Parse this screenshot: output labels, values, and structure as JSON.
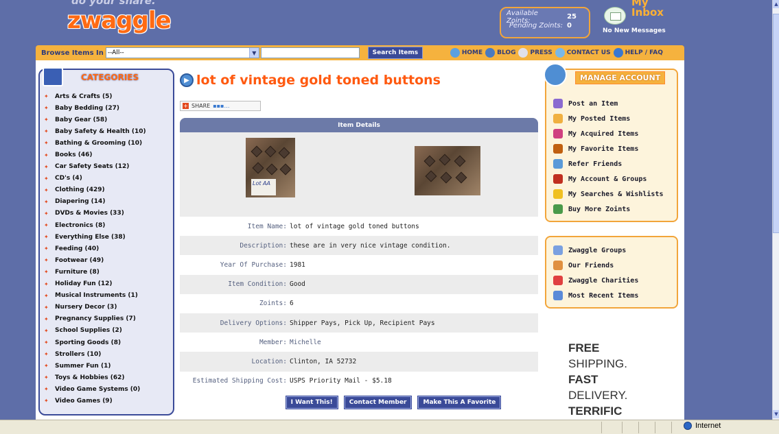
{
  "header": {
    "tagline": "do your share.",
    "logo": "zwaggle",
    "available_label": "Available Zoints:",
    "available_value": "25",
    "pending_label": "Pending Zoints:",
    "pending_value": "0",
    "inbox_title": "My Inbox",
    "inbox_sub": "No New Messages"
  },
  "nav": {
    "browse_label": "Browse Items In",
    "browse_value": "--All--",
    "search_button": "Search Items",
    "links": [
      "HOME",
      "BLOG",
      "PRESS",
      "CONTACT US",
      "HELP / FAQ"
    ]
  },
  "categories": {
    "title": "CATEGORIES",
    "items": [
      "Arts & Crafts (5)",
      "Baby Bedding (27)",
      "Baby Gear (58)",
      "Baby Safety & Health (10)",
      "Bathing & Grooming (10)",
      "Books (46)",
      "Car Safety Seats (12)",
      "CD's (4)",
      "Clothing (429)",
      "Diapering (14)",
      "DVDs & Movies (33)",
      "Electronics (8)",
      "Everything Else (38)",
      "Feeding (40)",
      "Footwear (49)",
      "Furniture (8)",
      "Holiday Fun (12)",
      "Musical Instruments (1)",
      "Nursery Decor (3)",
      "Pregnancy Supplies (7)",
      "School Supplies (2)",
      "Sporting Goods (8)",
      "Strollers (10)",
      "Summer Fun (1)",
      "Toys & Hobbies (62)",
      "Video Game Systems (0)",
      "Video Games (9)"
    ]
  },
  "item": {
    "title": "lot of vintage gold toned buttons",
    "share_label": "SHARE",
    "details_header": "Item Details",
    "photo_card_text": "Lot AA",
    "rows": [
      {
        "label": "Item Name:",
        "value": "lot of vintage gold toned buttons"
      },
      {
        "label": "Description:",
        "value": "these are in very nice vintage condition."
      },
      {
        "label": "Year Of Purchase:",
        "value": "1981"
      },
      {
        "label": "Item Condition:",
        "value": "Good"
      },
      {
        "label": "Zoints:",
        "value": "6"
      },
      {
        "label": "Delivery Options:",
        "value": "Shipper Pays, Pick Up, Recipient Pays"
      },
      {
        "label": "Member:",
        "value": "Michelle"
      },
      {
        "label": "Location:",
        "value": "Clinton, IA 52732"
      },
      {
        "label": "Estimated Shipping Cost:",
        "value": "USPS Priority Mail - $5.18"
      }
    ],
    "buttons": {
      "want": "I Want This!",
      "contact": "Contact Member",
      "favorite": "Make This A Favorite"
    }
  },
  "manage": {
    "title": "MANAGE ACCOUNT",
    "items": [
      "Post an Item",
      "My Posted Items",
      "My Acquired Items",
      "My Favorite Items",
      "Refer Friends",
      "My Account & Groups",
      "My Searches & Wishlists",
      "Buy More Zoints"
    ]
  },
  "groups": {
    "items": [
      "Zwaggle Groups",
      "Our Friends",
      "Zwaggle Charities",
      "Most Recent Items"
    ]
  },
  "ad": {
    "l1": "FREE",
    "l2": "SHIPPING.",
    "l3": "FAST",
    "l4": "DELIVERY.",
    "l5": "TERRIFIC"
  },
  "statusbar": {
    "zone": "Internet"
  }
}
